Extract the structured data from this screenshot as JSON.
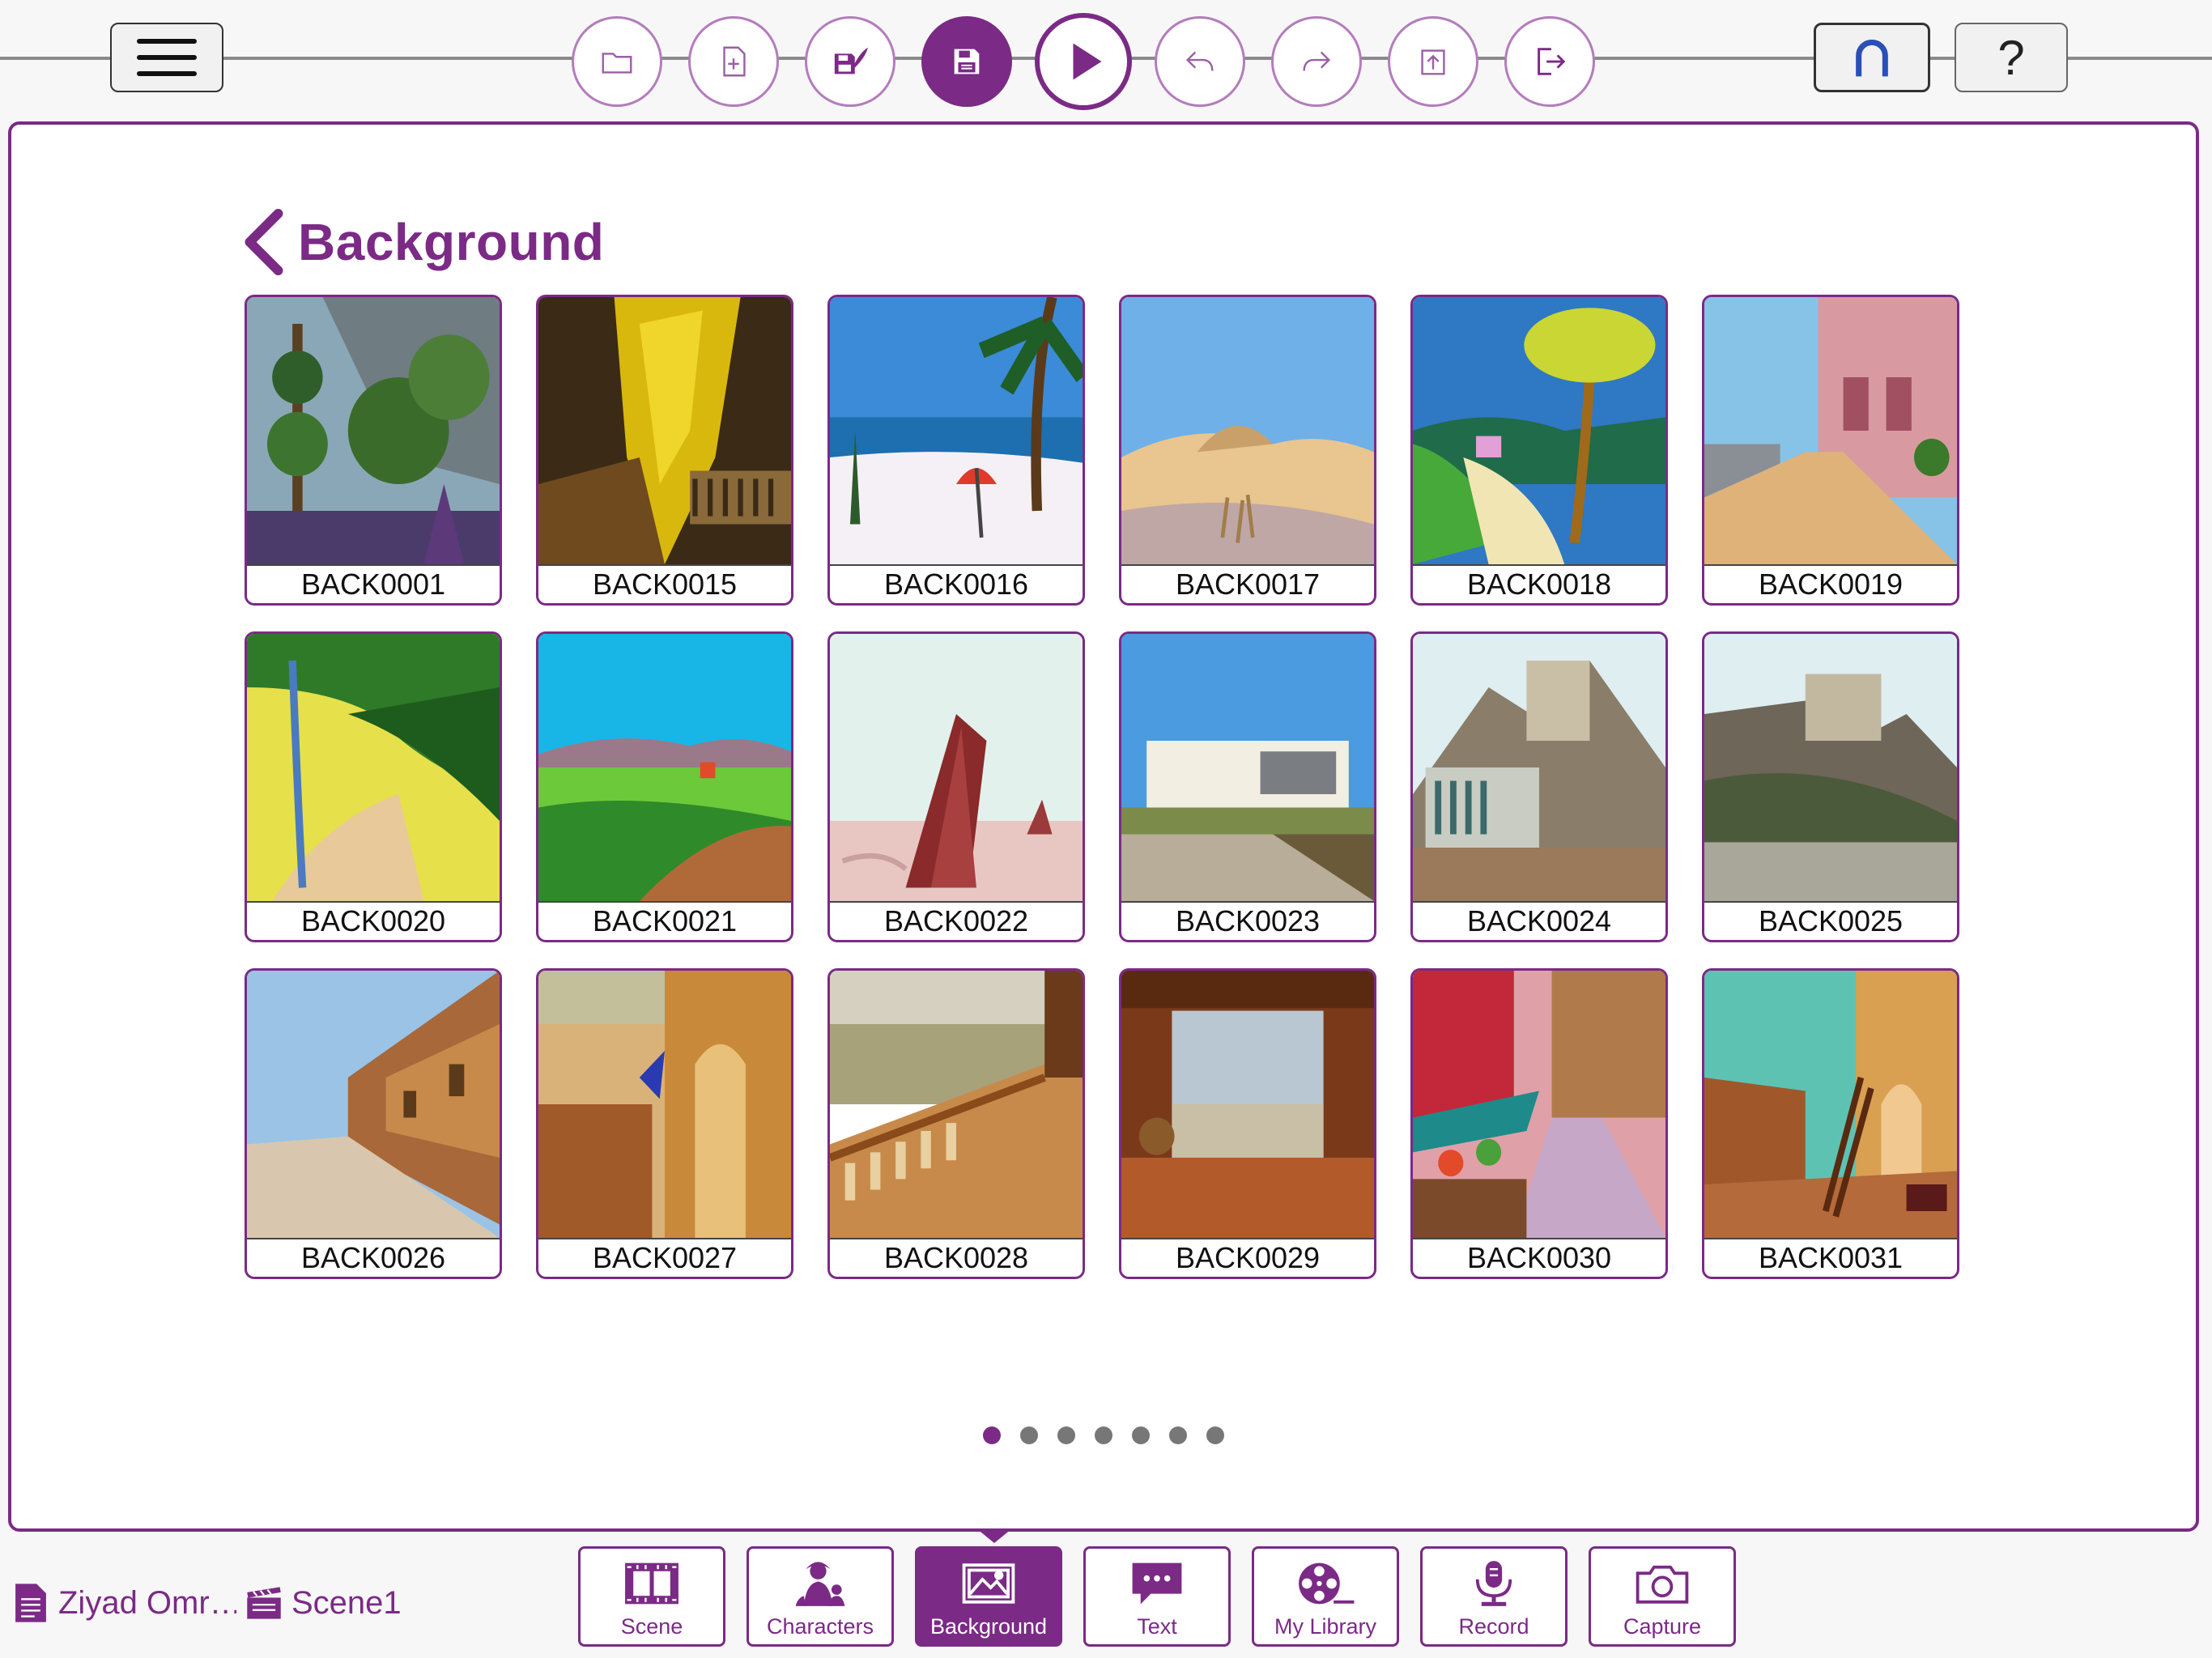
{
  "colors": {
    "accent": "#7b2a86",
    "accent_light": "#b47cbd",
    "dot_inactive": "#777777"
  },
  "toolbar": {
    "menu_icon": "hamburger-icon",
    "buttons": [
      {
        "name": "open-folder",
        "icon": "folder-icon"
      },
      {
        "name": "new-file",
        "icon": "new-file-icon"
      },
      {
        "name": "save-as",
        "icon": "save-as-icon"
      },
      {
        "name": "save",
        "icon": "save-icon"
      },
      {
        "name": "play",
        "icon": "play-icon"
      },
      {
        "name": "undo",
        "icon": "undo-icon"
      },
      {
        "name": "redo",
        "icon": "redo-icon"
      },
      {
        "name": "export",
        "icon": "export-icon"
      },
      {
        "name": "exit",
        "icon": "exit-icon"
      }
    ],
    "magnet_icon": "magnet-icon",
    "help_label": "?"
  },
  "panel": {
    "title": "Background",
    "items": [
      {
        "label": "BACK0001"
      },
      {
        "label": "BACK0015"
      },
      {
        "label": "BACK0016"
      },
      {
        "label": "BACK0017"
      },
      {
        "label": "BACK0018"
      },
      {
        "label": "BACK0019"
      },
      {
        "label": "BACK0020"
      },
      {
        "label": "BACK0021"
      },
      {
        "label": "BACK0022"
      },
      {
        "label": "BACK0023"
      },
      {
        "label": "BACK0024"
      },
      {
        "label": "BACK0025"
      },
      {
        "label": "BACK0026"
      },
      {
        "label": "BACK0027"
      },
      {
        "label": "BACK0028"
      },
      {
        "label": "BACK0029"
      },
      {
        "label": "BACK0030"
      },
      {
        "label": "BACK0031"
      }
    ],
    "pagination": {
      "total": 7,
      "current": 1
    }
  },
  "footer": {
    "project_name": "Ziyad Omr…",
    "scene_name": "Scene1",
    "tabs": [
      {
        "label": "Scene",
        "icon": "film-strip-icon",
        "active": false
      },
      {
        "label": "Characters",
        "icon": "characters-icon",
        "active": false
      },
      {
        "label": "Background",
        "icon": "picture-icon",
        "active": true
      },
      {
        "label": "Text",
        "icon": "speech-bubble-icon",
        "active": false
      },
      {
        "label": "My Library",
        "icon": "film-reel-icon",
        "active": false
      },
      {
        "label": "Record",
        "icon": "microphone-icon",
        "active": false
      },
      {
        "label": "Capture",
        "icon": "camera-icon",
        "active": false
      }
    ]
  }
}
